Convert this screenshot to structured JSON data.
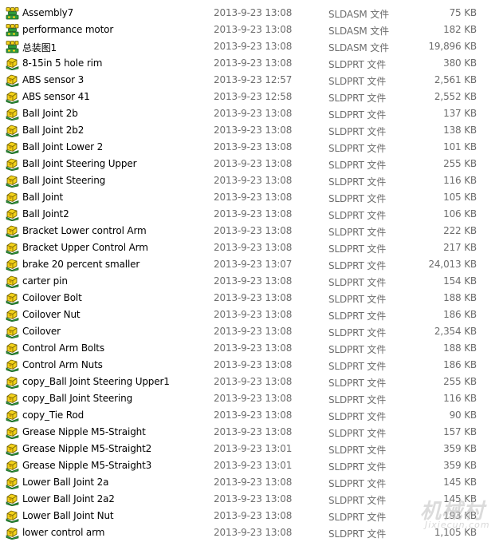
{
  "file_list": {
    "rows": [
      {
        "name": "Assembly7",
        "date": "2013-9-23 13:08",
        "type": "SLDASM 文件",
        "size": "75 KB",
        "icon": "sldasm-file-icon"
      },
      {
        "name": "performance motor",
        "date": "2013-9-23 13:08",
        "type": "SLDASM 文件",
        "size": "182 KB",
        "icon": "sldasm-file-icon"
      },
      {
        "name": "总装图1",
        "date": "2013-9-23 13:08",
        "type": "SLDASM 文件",
        "size": "19,896 KB",
        "icon": "sldasm-file-icon"
      },
      {
        "name": "8-15in 5 hole rim",
        "date": "2013-9-23 13:08",
        "type": "SLDPRT 文件",
        "size": "380 KB",
        "icon": "sldprt-file-icon"
      },
      {
        "name": "ABS sensor 3",
        "date": "2013-9-23 12:57",
        "type": "SLDPRT 文件",
        "size": "2,561 KB",
        "icon": "sldprt-file-icon"
      },
      {
        "name": "ABS sensor 41",
        "date": "2013-9-23 12:58",
        "type": "SLDPRT 文件",
        "size": "2,552 KB",
        "icon": "sldprt-file-icon"
      },
      {
        "name": "Ball Joint 2b",
        "date": "2013-9-23 13:08",
        "type": "SLDPRT 文件",
        "size": "137 KB",
        "icon": "sldprt-file-icon"
      },
      {
        "name": "Ball Joint 2b2",
        "date": "2013-9-23 13:08",
        "type": "SLDPRT 文件",
        "size": "138 KB",
        "icon": "sldprt-file-icon"
      },
      {
        "name": "Ball Joint Lower 2",
        "date": "2013-9-23 13:08",
        "type": "SLDPRT 文件",
        "size": "101 KB",
        "icon": "sldprt-file-icon"
      },
      {
        "name": "Ball Joint Steering Upper",
        "date": "2013-9-23 13:08",
        "type": "SLDPRT 文件",
        "size": "255 KB",
        "icon": "sldprt-file-icon"
      },
      {
        "name": "Ball Joint Steering",
        "date": "2013-9-23 13:08",
        "type": "SLDPRT 文件",
        "size": "116 KB",
        "icon": "sldprt-file-icon"
      },
      {
        "name": "Ball Joint",
        "date": "2013-9-23 13:08",
        "type": "SLDPRT 文件",
        "size": "105 KB",
        "icon": "sldprt-file-icon"
      },
      {
        "name": "Ball Joint2",
        "date": "2013-9-23 13:08",
        "type": "SLDPRT 文件",
        "size": "106 KB",
        "icon": "sldprt-file-icon"
      },
      {
        "name": "Bracket Lower control Arm",
        "date": "2013-9-23 13:08",
        "type": "SLDPRT 文件",
        "size": "222 KB",
        "icon": "sldprt-file-icon"
      },
      {
        "name": "Bracket Upper Control Arm",
        "date": "2013-9-23 13:08",
        "type": "SLDPRT 文件",
        "size": "217 KB",
        "icon": "sldprt-file-icon"
      },
      {
        "name": "brake 20 percent smaller",
        "date": "2013-9-23 13:07",
        "type": "SLDPRT 文件",
        "size": "24,013 KB",
        "icon": "sldprt-file-icon"
      },
      {
        "name": "carter pin",
        "date": "2013-9-23 13:08",
        "type": "SLDPRT 文件",
        "size": "154 KB",
        "icon": "sldprt-file-icon"
      },
      {
        "name": "Coilover Bolt",
        "date": "2013-9-23 13:08",
        "type": "SLDPRT 文件",
        "size": "188 KB",
        "icon": "sldprt-file-icon"
      },
      {
        "name": "Coilover Nut",
        "date": "2013-9-23 13:08",
        "type": "SLDPRT 文件",
        "size": "186 KB",
        "icon": "sldprt-file-icon"
      },
      {
        "name": "Coilover",
        "date": "2013-9-23 13:08",
        "type": "SLDPRT 文件",
        "size": "2,354 KB",
        "icon": "sldprt-file-icon"
      },
      {
        "name": "Control Arm Bolts",
        "date": "2013-9-23 13:08",
        "type": "SLDPRT 文件",
        "size": "188 KB",
        "icon": "sldprt-file-icon"
      },
      {
        "name": "Control Arm Nuts",
        "date": "2013-9-23 13:08",
        "type": "SLDPRT 文件",
        "size": "186 KB",
        "icon": "sldprt-file-icon"
      },
      {
        "name": "copy_Ball Joint Steering Upper1",
        "date": "2013-9-23 13:08",
        "type": "SLDPRT 文件",
        "size": "255 KB",
        "icon": "sldprt-file-icon"
      },
      {
        "name": "copy_Ball Joint Steering",
        "date": "2013-9-23 13:08",
        "type": "SLDPRT 文件",
        "size": "116 KB",
        "icon": "sldprt-file-icon"
      },
      {
        "name": "copy_Tie Rod",
        "date": "2013-9-23 13:08",
        "type": "SLDPRT 文件",
        "size": "90 KB",
        "icon": "sldprt-file-icon"
      },
      {
        "name": "Grease Nipple M5-Straight",
        "date": "2013-9-23 13:08",
        "type": "SLDPRT 文件",
        "size": "157 KB",
        "icon": "sldprt-file-icon"
      },
      {
        "name": "Grease Nipple M5-Straight2",
        "date": "2013-9-23 13:01",
        "type": "SLDPRT 文件",
        "size": "359 KB",
        "icon": "sldprt-file-icon"
      },
      {
        "name": "Grease Nipple M5-Straight3",
        "date": "2013-9-23 13:01",
        "type": "SLDPRT 文件",
        "size": "359 KB",
        "icon": "sldprt-file-icon"
      },
      {
        "name": "Lower Ball Joint 2a",
        "date": "2013-9-23 13:08",
        "type": "SLDPRT 文件",
        "size": "145 KB",
        "icon": "sldprt-file-icon"
      },
      {
        "name": "Lower Ball Joint 2a2",
        "date": "2013-9-23 13:08",
        "type": "SLDPRT 文件",
        "size": "145 KB",
        "icon": "sldprt-file-icon"
      },
      {
        "name": "Lower Ball Joint Nut",
        "date": "2013-9-23 13:08",
        "type": "SLDPRT 文件",
        "size": "193 KB",
        "icon": "sldprt-file-icon"
      },
      {
        "name": "lower control arm",
        "date": "2013-9-23 13:08",
        "type": "SLDPRT 文件",
        "size": "1,105 KB",
        "icon": "sldprt-file-icon"
      }
    ]
  },
  "watermark": {
    "main": "机械村",
    "sub": "Jixiecun.com"
  }
}
